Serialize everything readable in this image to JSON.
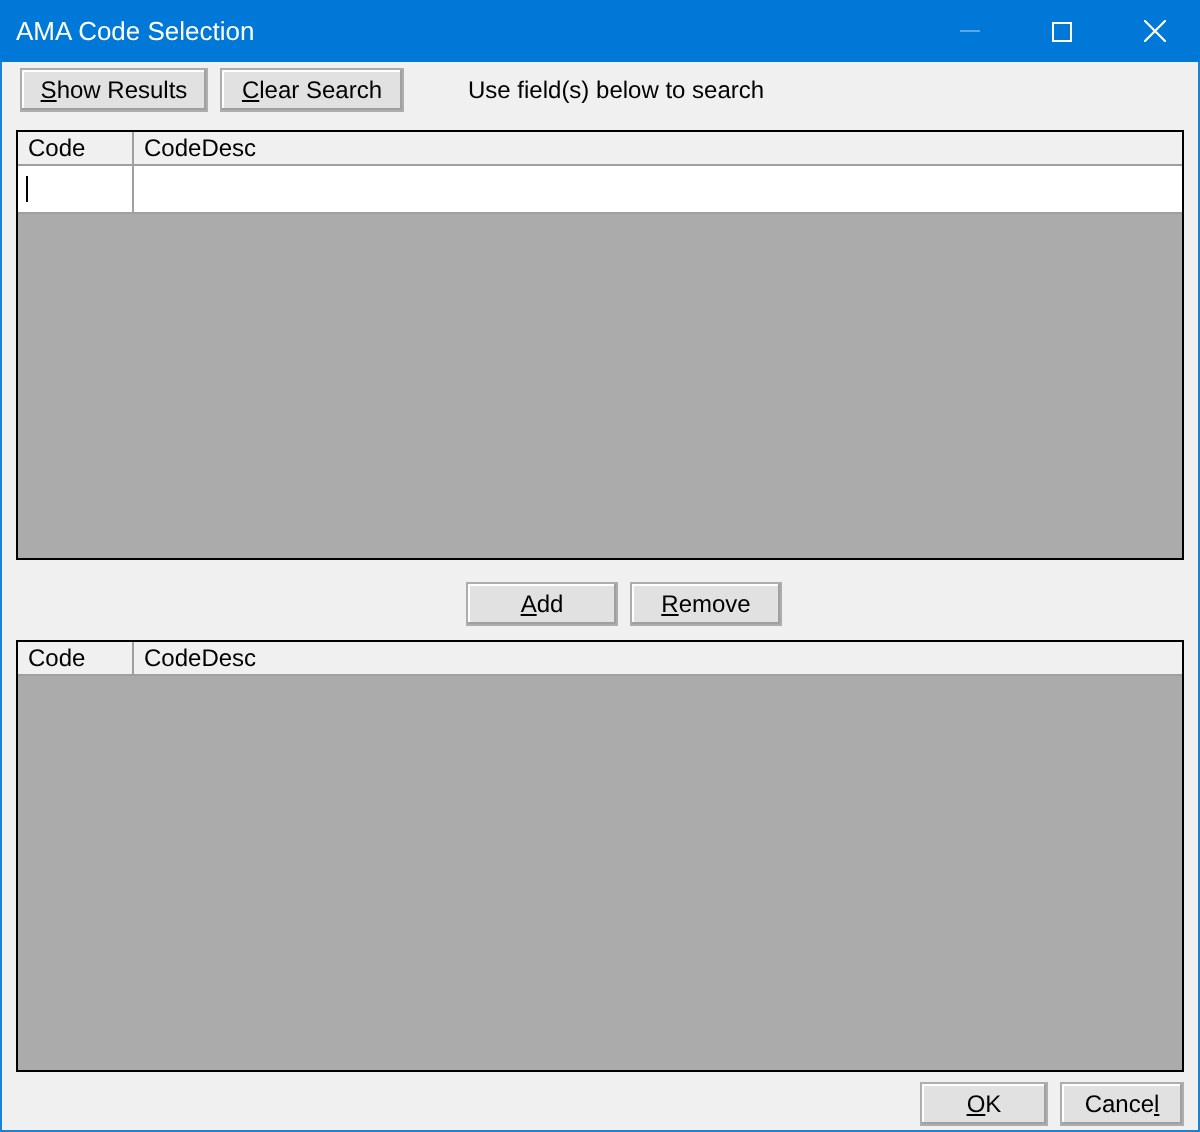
{
  "window": {
    "title": "AMA Code Selection",
    "controls": [
      {
        "kind": "minimize",
        "disabled": true
      },
      {
        "kind": "maximize",
        "disabled": false
      },
      {
        "kind": "close",
        "disabled": false
      }
    ]
  },
  "toolbar": {
    "buttons": [
      {
        "key": "S",
        "rest": "how Results"
      },
      {
        "key": "C",
        "rest": "lear Search"
      }
    ],
    "hint": "Use field(s) below to search"
  },
  "search_grid": {
    "columns": [
      "Code",
      "CodeDesc"
    ],
    "new_row": {
      "focused": true
    }
  },
  "middle_buttons": [
    {
      "key": "A",
      "rest": "dd"
    },
    {
      "key": "R",
      "rest": "emove"
    }
  ],
  "selected_grid": {
    "columns": [
      "Code",
      "CodeDesc"
    ]
  },
  "dialog_buttons": [
    {
      "key": "O",
      "rest": "K"
    },
    {
      "lead": "Cance",
      "key": "l"
    }
  ]
}
